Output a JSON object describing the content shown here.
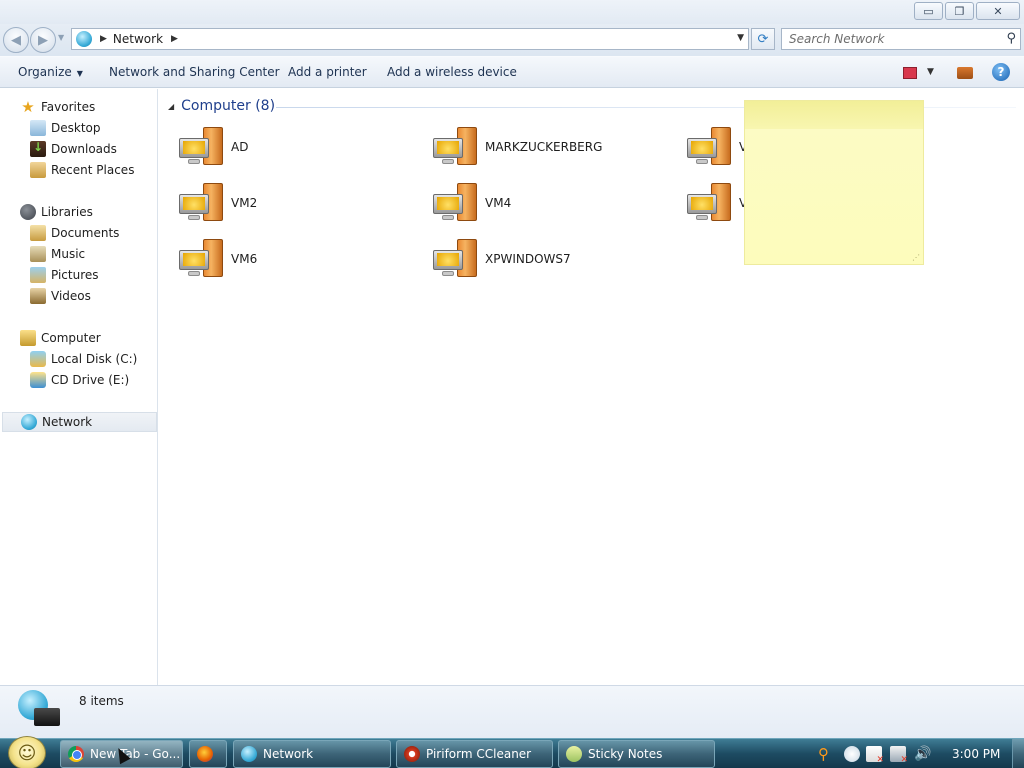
{
  "window": {
    "caption_buttons": [
      {
        "name": "minimize-button",
        "glyph": "▭"
      },
      {
        "name": "restore-button",
        "glyph": "❐"
      },
      {
        "name": "close-button",
        "glyph": "✕"
      }
    ]
  },
  "address": {
    "breadcrumb": "Network",
    "search_placeholder": "Search Network"
  },
  "commandbar": {
    "organize": "Organize",
    "network_sharing": "Network and Sharing Center",
    "add_printer": "Add a printer",
    "add_wireless": "Add a wireless device"
  },
  "navpane": {
    "favorites": "Favorites",
    "desktop": "Desktop",
    "downloads": "Downloads",
    "recent": "Recent Places",
    "libraries": "Libraries",
    "documents": "Documents",
    "music": "Music",
    "pictures": "Pictures",
    "videos": "Videos",
    "computer": "Computer",
    "local_disk": "Local Disk (C:)",
    "cd_drive": "CD Drive (E:)",
    "network": "Network"
  },
  "content": {
    "group_title": "Computer (8)",
    "items": [
      {
        "name": "AD"
      },
      {
        "name": "MARKZUCKERBERG"
      },
      {
        "name": "V"
      },
      {
        "name": "VM2"
      },
      {
        "name": "VM4"
      },
      {
        "name": "V"
      },
      {
        "name": "VM6"
      },
      {
        "name": "XPWINDOWS7"
      }
    ]
  },
  "details": {
    "item_count": "8 items"
  },
  "taskbar": {
    "buttons": [
      {
        "label": "New Tab - Go...",
        "icon": "chrome-icon"
      },
      {
        "label": "",
        "icon": "firefox-icon"
      },
      {
        "label": "Network",
        "icon": "network-icon"
      },
      {
        "label": "Piriform CCleaner",
        "icon": "ccleaner-icon"
      },
      {
        "label": "Sticky Notes",
        "icon": "sticky-notes-icon"
      }
    ],
    "clock": "3:00 PM"
  },
  "colors": {
    "group_title": "#1f3f8c",
    "taskbar": "#1e4c63",
    "sticky_note": "#fdfcbc"
  }
}
